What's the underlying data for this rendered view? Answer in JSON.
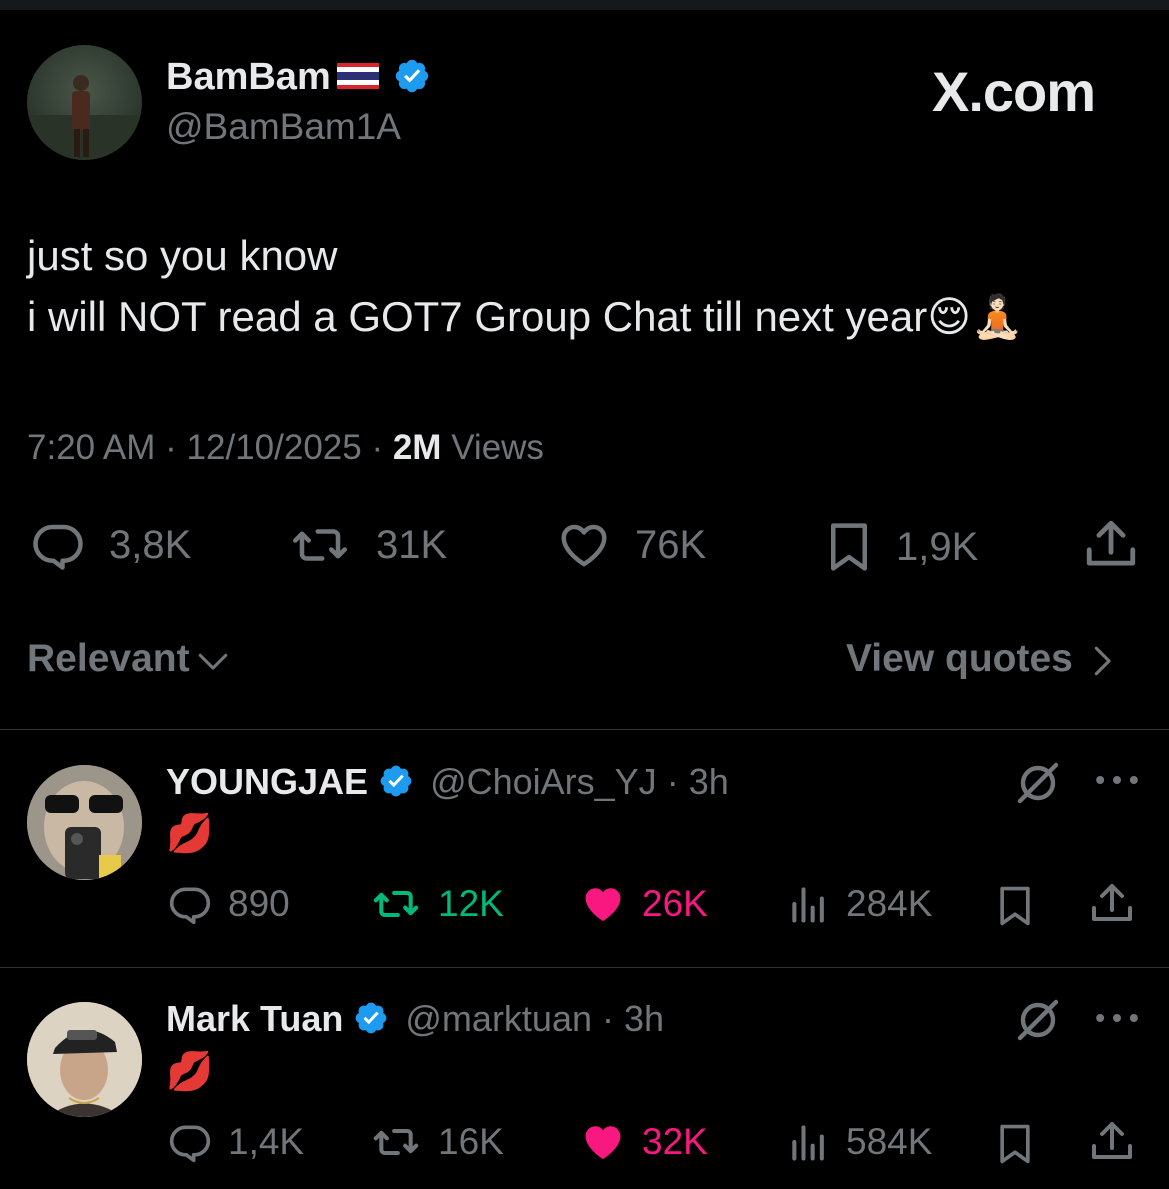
{
  "watermark": "X.com",
  "tweet": {
    "display_name": "BamBam",
    "handle": "@BamBam1A",
    "text_line1": "just so you know",
    "text_line2": "i will NOT read a GOT7 Group Chat till next year",
    "emojis": "😌🧘🏻",
    "time": "7:20 AM",
    "sep1": "·",
    "date": "12/10/2025",
    "sep2": "·",
    "views_count": "2M",
    "views_label": "Views",
    "replies": "3,8K",
    "reposts": "31K",
    "likes": "76K",
    "bookmarks": "1,9K"
  },
  "replies_bar": {
    "sort_label": "Relevant",
    "quotes_label": "View quotes"
  },
  "replies": [
    {
      "display_name": "YOUNGJAE",
      "handle": "@ChoiArs_YJ",
      "sep": "·",
      "time": "3h",
      "text": "💋",
      "replies": "890",
      "reposts": "12K",
      "likes": "26K",
      "views": "284K",
      "reposted": true,
      "liked": true
    },
    {
      "display_name": "Mark Tuan",
      "handle": "@marktuan",
      "sep": "·",
      "time": "3h",
      "text": "💋",
      "replies": "1,4K",
      "reposts": "16K",
      "likes": "32K",
      "views": "584K",
      "reposted": false,
      "liked": true
    }
  ],
  "colors": {
    "background": "#000000",
    "text": "#e7e9ea",
    "muted": "#71767b",
    "verified": "#1d9bf0",
    "repost_active": "#00ba7c",
    "like_active": "#f91880",
    "divider": "#2f3336"
  }
}
